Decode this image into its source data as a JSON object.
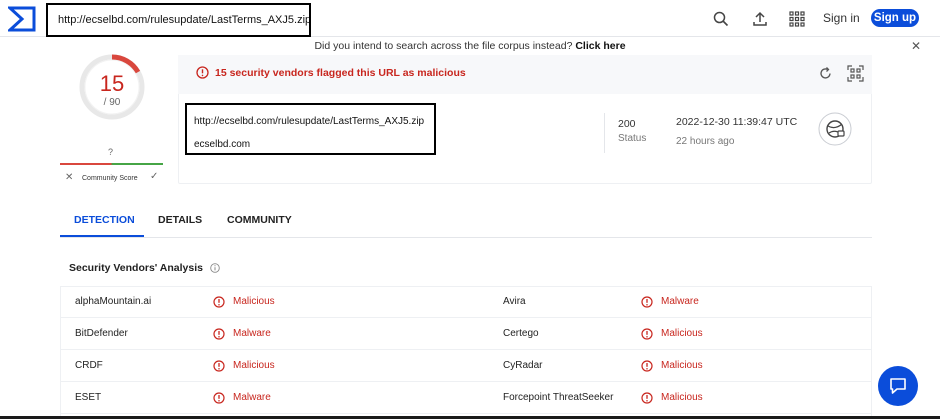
{
  "topbar": {
    "search_value": "http://ecselbd.com/rulesupdate/LastTerms_AXJ5.zip",
    "signin_label": "Sign in",
    "signup_label": "Sign up"
  },
  "suggest": {
    "text": "Did you intend to search across the file corpus instead?",
    "link": "Click here"
  },
  "score": {
    "detections": "15",
    "total": "/ 90",
    "community_value": "?",
    "community_label": "Community Score",
    "fraction": 0.1667
  },
  "summary": {
    "flag_text": "15 security vendors flagged this URL as malicious",
    "url": "http://ecselbd.com/rulesupdate/LastTerms_AXJ5.zip",
    "domain": "ecselbd.com",
    "status_code": "200",
    "status_label": "Status",
    "date": "2022-12-30 11:39:47 UTC",
    "ago": "22 hours ago"
  },
  "tabs": [
    "DETECTION",
    "DETAILS",
    "COMMUNITY"
  ],
  "vendors": {
    "title": "Security Vendors' Analysis",
    "rows": [
      {
        "left_name": "alphaMountain.ai",
        "left_result": "Malicious",
        "right_name": "Avira",
        "right_result": "Malware"
      },
      {
        "left_name": "BitDefender",
        "left_result": "Malware",
        "right_name": "Certego",
        "right_result": "Malicious"
      },
      {
        "left_name": "CRDF",
        "left_result": "Malicious",
        "right_name": "CyRadar",
        "right_result": "Malicious"
      },
      {
        "left_name": "ESET",
        "left_result": "Malware",
        "right_name": "Forcepoint ThreatSeeker",
        "right_result": "Malicious"
      }
    ]
  },
  "colors": {
    "accent": "#0b4dda",
    "danger": "#c8261e"
  },
  "icons": [
    "virustotal-logo-icon",
    "search-icon",
    "upload-icon",
    "apps-grid-icon",
    "close-icon",
    "alert-icon",
    "reload-icon",
    "qr-code-icon",
    "url-globe-icon",
    "info-icon",
    "chat-icon"
  ]
}
